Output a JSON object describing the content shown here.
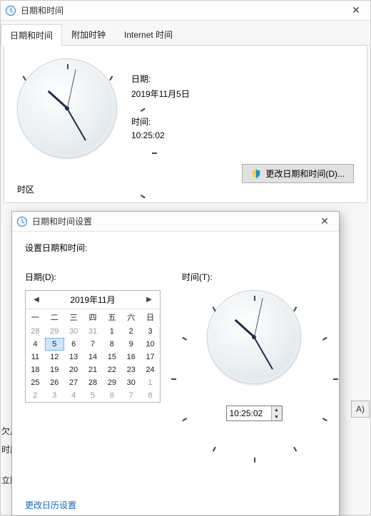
{
  "main": {
    "title": "日期和时间",
    "tabs": [
      "日期和时间",
      "附加时钟",
      "Internet 时间"
    ],
    "date_label": "日期:",
    "date_value": "2019年11月5日",
    "time_label": "时间:",
    "time_value": "10:25:02",
    "change_button": "更改日期和时间(D)...",
    "timezone_label": "时区",
    "ghost_button": "A)"
  },
  "dialog": {
    "title": "日期和时间设置",
    "set_label": "设置日期和时间:",
    "date_field_label": "日期(D):",
    "time_field_label": "时间(T):",
    "time_input_value": "10:25:02",
    "calendar": {
      "title": "2019年11月",
      "dow": [
        "一",
        "二",
        "三",
        "四",
        "五",
        "六",
        "日"
      ],
      "rows": [
        [
          {
            "n": 28,
            "other": true
          },
          {
            "n": 29,
            "other": true
          },
          {
            "n": 30,
            "other": true
          },
          {
            "n": 31,
            "other": true
          },
          {
            "n": 1
          },
          {
            "n": 2
          },
          {
            "n": 3
          }
        ],
        [
          {
            "n": 4
          },
          {
            "n": 5,
            "sel": true
          },
          {
            "n": 6
          },
          {
            "n": 7
          },
          {
            "n": 8
          },
          {
            "n": 9
          },
          {
            "n": 10
          }
        ],
        [
          {
            "n": 11
          },
          {
            "n": 12
          },
          {
            "n": 13
          },
          {
            "n": 14
          },
          {
            "n": 15
          },
          {
            "n": 16
          },
          {
            "n": 17
          }
        ],
        [
          {
            "n": 18
          },
          {
            "n": 19
          },
          {
            "n": 20
          },
          {
            "n": 21
          },
          {
            "n": 22
          },
          {
            "n": 23
          },
          {
            "n": 24
          }
        ],
        [
          {
            "n": 25
          },
          {
            "n": 26
          },
          {
            "n": 27
          },
          {
            "n": 28
          },
          {
            "n": 29
          },
          {
            "n": 30
          },
          {
            "n": 1,
            "other": true
          }
        ],
        [
          {
            "n": 2,
            "other": true
          },
          {
            "n": 3,
            "other": true
          },
          {
            "n": 4,
            "other": true
          },
          {
            "n": 5,
            "other": true
          },
          {
            "n": 6,
            "other": true
          },
          {
            "n": 7,
            "other": true
          },
          {
            "n": 8,
            "other": true
          }
        ]
      ]
    },
    "change_calendar_link": "更改日历设置"
  },
  "side": {
    "t1": "欠反",
    "t2": "时朋",
    "t3": "立即"
  },
  "clock": {
    "hour_deg": 312,
    "minute_deg": 150,
    "second_deg": 12
  }
}
